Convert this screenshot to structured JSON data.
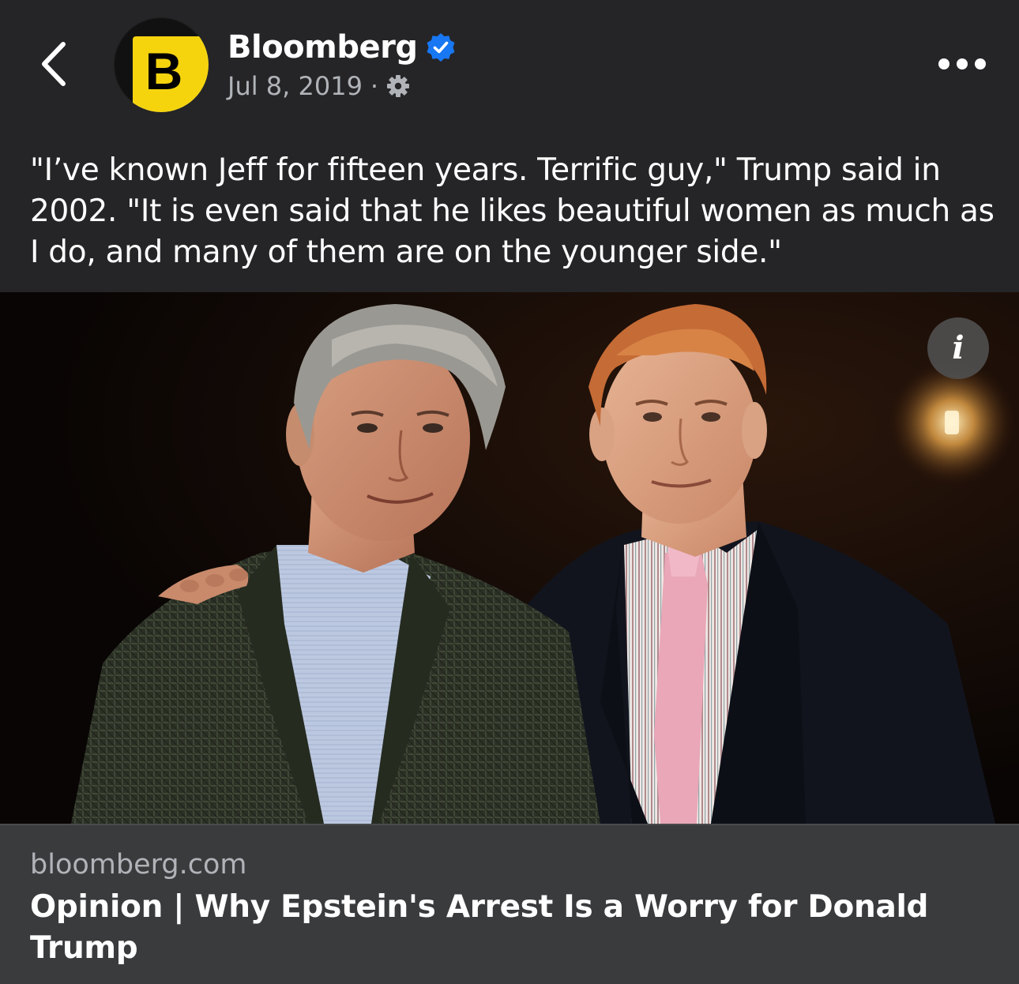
{
  "header": {
    "back_icon": "chevron-left-icon",
    "avatar_letter": "B",
    "page_name": "Bloomberg",
    "verified_icon": "verified-badge-icon",
    "date": "Jul 8, 2019",
    "separator": "·",
    "privacy_icon": "gear-icon",
    "more_icon": "more-horizontal-icon"
  },
  "post": {
    "caption": "\"I’ve known Jeff for fifteen years. Terrific guy,\" Trump said in 2002. \"It is even said that he likes beautiful women as much as I do, and many of them are on the younger side.\""
  },
  "photo": {
    "info_glyph": "i",
    "info_icon": "info-icon"
  },
  "link_preview": {
    "domain": "bloomberg.com",
    "title": "Opinion | Why Epstein's Arrest Is a Worry for Donald Trump"
  },
  "colors": {
    "background": "#252527",
    "link_card": "#3a3b3d",
    "secondary_text": "#b0b3b8",
    "verified_blue": "#1877f2",
    "brand_yellow": "#f5d40e"
  }
}
